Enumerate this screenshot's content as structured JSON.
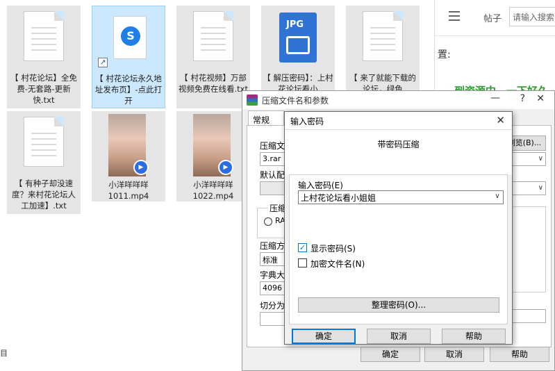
{
  "explorer": {
    "files": [
      {
        "label": "【 村花论坛】全免费-无套路-更新快.txt",
        "type": "txt"
      },
      {
        "label": "【 村花论坛永久地址发布页】-点此打开",
        "type": "shortcut"
      },
      {
        "label": "【 村花视频】万部视频免费在线看.txt",
        "type": "txt"
      },
      {
        "label": "【 解压密码】：上村花论坛看小",
        "type": "jpg",
        "badge": "JPG"
      },
      {
        "label": "【 来了就能下载的论坛，绿色",
        "type": "txt"
      },
      {
        "label": "【 有种子却没速度？来村花论坛人工加速】.txt",
        "type": "txt"
      },
      {
        "label": "小洋咩咩咩1011.mp4",
        "type": "mp4"
      },
      {
        "label": "小洋咩咩咩1022.mp4",
        "type": "mp4"
      }
    ],
    "status_fragment": "目"
  },
  "browser": {
    "tab_label": "帖子",
    "search_placeholder": "请输入搜索",
    "text_fragment": "置:",
    "green_fragment": "到资源中，一下好久"
  },
  "main_dialog": {
    "title": "压缩文件名和参数",
    "minimize": "—",
    "help": "?",
    "close": "✕",
    "tab_general": "常规",
    "archive_name_label": "压缩文",
    "archive_name_value": "3.rar",
    "browse_button": "浏览(B)...",
    "default_profile_label": "默认配",
    "format_group_label": "压缩文",
    "format_radio": "RA",
    "method_label": "压缩方",
    "method_value": "标准",
    "dict_label": "字典大",
    "dict_value": "4096 1",
    "split_label": "切分为",
    "ok_button": "确定",
    "cancel_button": "取消",
    "help_button": "帮助"
  },
  "pw_dialog": {
    "title": "输入密码",
    "close": "✕",
    "heading": "带密码压缩",
    "password_label": "输入密码(E)",
    "password_value": "上村花论坛看小姐姐",
    "show_password_label": "显示密码(S)",
    "show_password_checked": true,
    "encrypt_names_label": "加密文件名(N)",
    "encrypt_names_checked": false,
    "organize_button": "整理密码(O)...",
    "ok_button": "确定",
    "cancel_button": "取消",
    "help_button": "帮助"
  },
  "colors": {
    "selection": "#cce8ff",
    "accent": "#0078d7",
    "dialog_bg": "#f0f0f0"
  }
}
